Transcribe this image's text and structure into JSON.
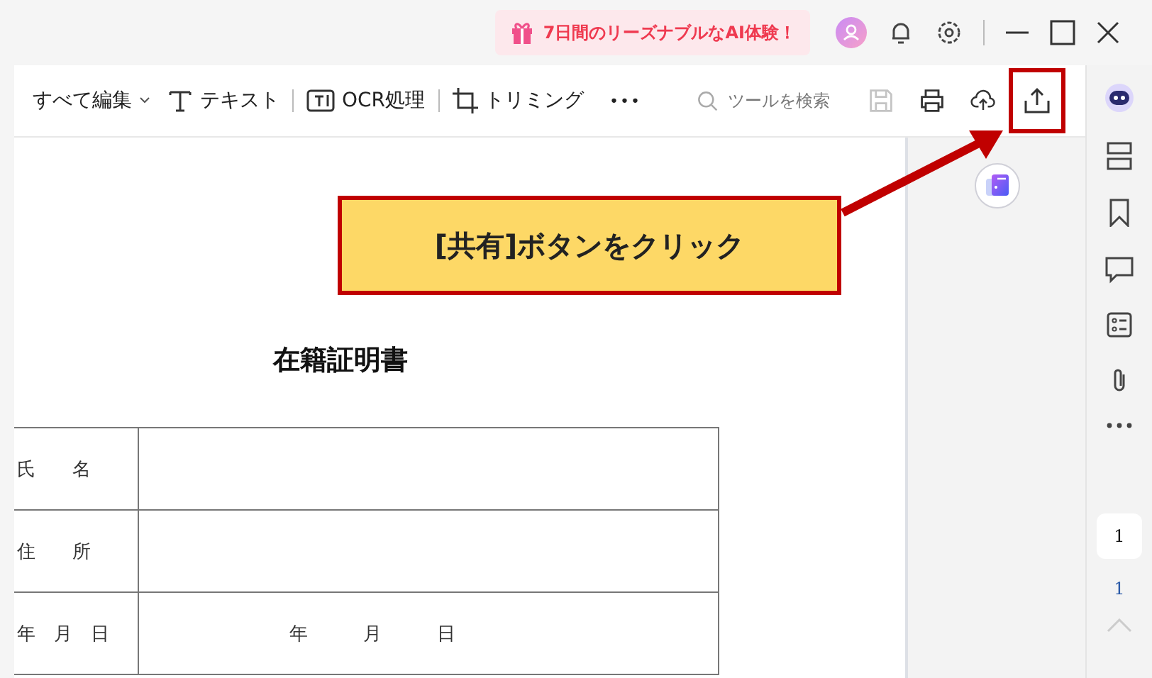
{
  "title_bar": {
    "promo": "7日間のリーズナブルなAI体験！"
  },
  "toolbar": {
    "items": [
      {
        "kind": "dropdown",
        "label": "すべて編集"
      },
      {
        "kind": "text",
        "label": "テキスト"
      },
      {
        "kind": "ocr",
        "label": "OCR処理"
      },
      {
        "kind": "crop",
        "label": "トリミング"
      },
      {
        "kind": "more",
        "label": "•••"
      }
    ],
    "search": {
      "placeholder": "ツールを検索"
    },
    "actions": [
      {
        "kind": "save",
        "disabled": true,
        "highlighted": false
      },
      {
        "kind": "print",
        "disabled": false,
        "highlighted": false
      },
      {
        "kind": "upload",
        "disabled": false,
        "highlighted": false
      },
      {
        "kind": "share",
        "disabled": false,
        "highlighted": true
      }
    ]
  },
  "document": {
    "title": "在籍証明書",
    "rows": [
      {
        "label": "氏　　名"
      },
      {
        "label": "住　　所"
      },
      {
        "label": "年　月　日",
        "value": "年　　　月　　　日"
      }
    ]
  },
  "sidebar": {
    "icons": [
      {
        "kind": "assistant"
      },
      {
        "kind": "layout"
      },
      {
        "kind": "bookmark"
      },
      {
        "kind": "comment"
      },
      {
        "kind": "form"
      },
      {
        "kind": "attachment"
      },
      {
        "kind": "more"
      }
    ],
    "page_nav": {
      "current": "1",
      "total": "1"
    }
  },
  "callout": {
    "text": "[共有]ボタンをクリック"
  }
}
